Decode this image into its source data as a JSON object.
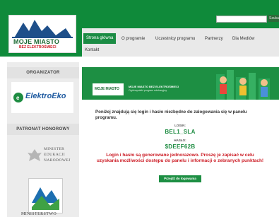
{
  "header": {
    "logo_title": "MOJE MIASTO",
    "logo_subtitle": "BEZ ELEKTROŚMIECI",
    "search_placeholder": "",
    "search_button": "Szuka"
  },
  "nav": {
    "items": [
      "Strona główna",
      "O programie",
      "Uczestnicy programu",
      "Partnerzy",
      "Dla Mediów"
    ],
    "second_row": "Kontakt"
  },
  "sidebar": {
    "organizer_heading": "ORGANIZATOR",
    "organizer_logo": "ElektroEko",
    "patron_heading": "PATRONAT HONOROWY",
    "ministry_line1": "MINISTER",
    "ministry_line2": "EDUKACJI",
    "ministry_line3": "NARODOWEJ",
    "ministry2_label": "MINISTERSTWO"
  },
  "banner": {
    "logo_title": "MOJE MIASTO",
    "title": "MOJE MIASTO BEZ ELEKTROŚMIECI",
    "subtitle": "Ogólnopolski program edukacyjny"
  },
  "content": {
    "intro": "Poniżej znajdują się login i hasło niezbędne do zalogowania się w panelu programu.",
    "login_label": "LOGIN:",
    "login_value": "BEL1_SLA",
    "password_label": "HASŁO:",
    "password_value": "$DEEF62B",
    "warning": "Login i hasło są generowane jednorazowo. Proszę je zapisać w celu uzyskania możliwości dostępu do panelu i informacji o zebranych punktach!",
    "login_button": "Przejdź do logowania"
  },
  "colors": {
    "brand_green": "#0f8a3a",
    "accent_red": "#cc1b24"
  }
}
